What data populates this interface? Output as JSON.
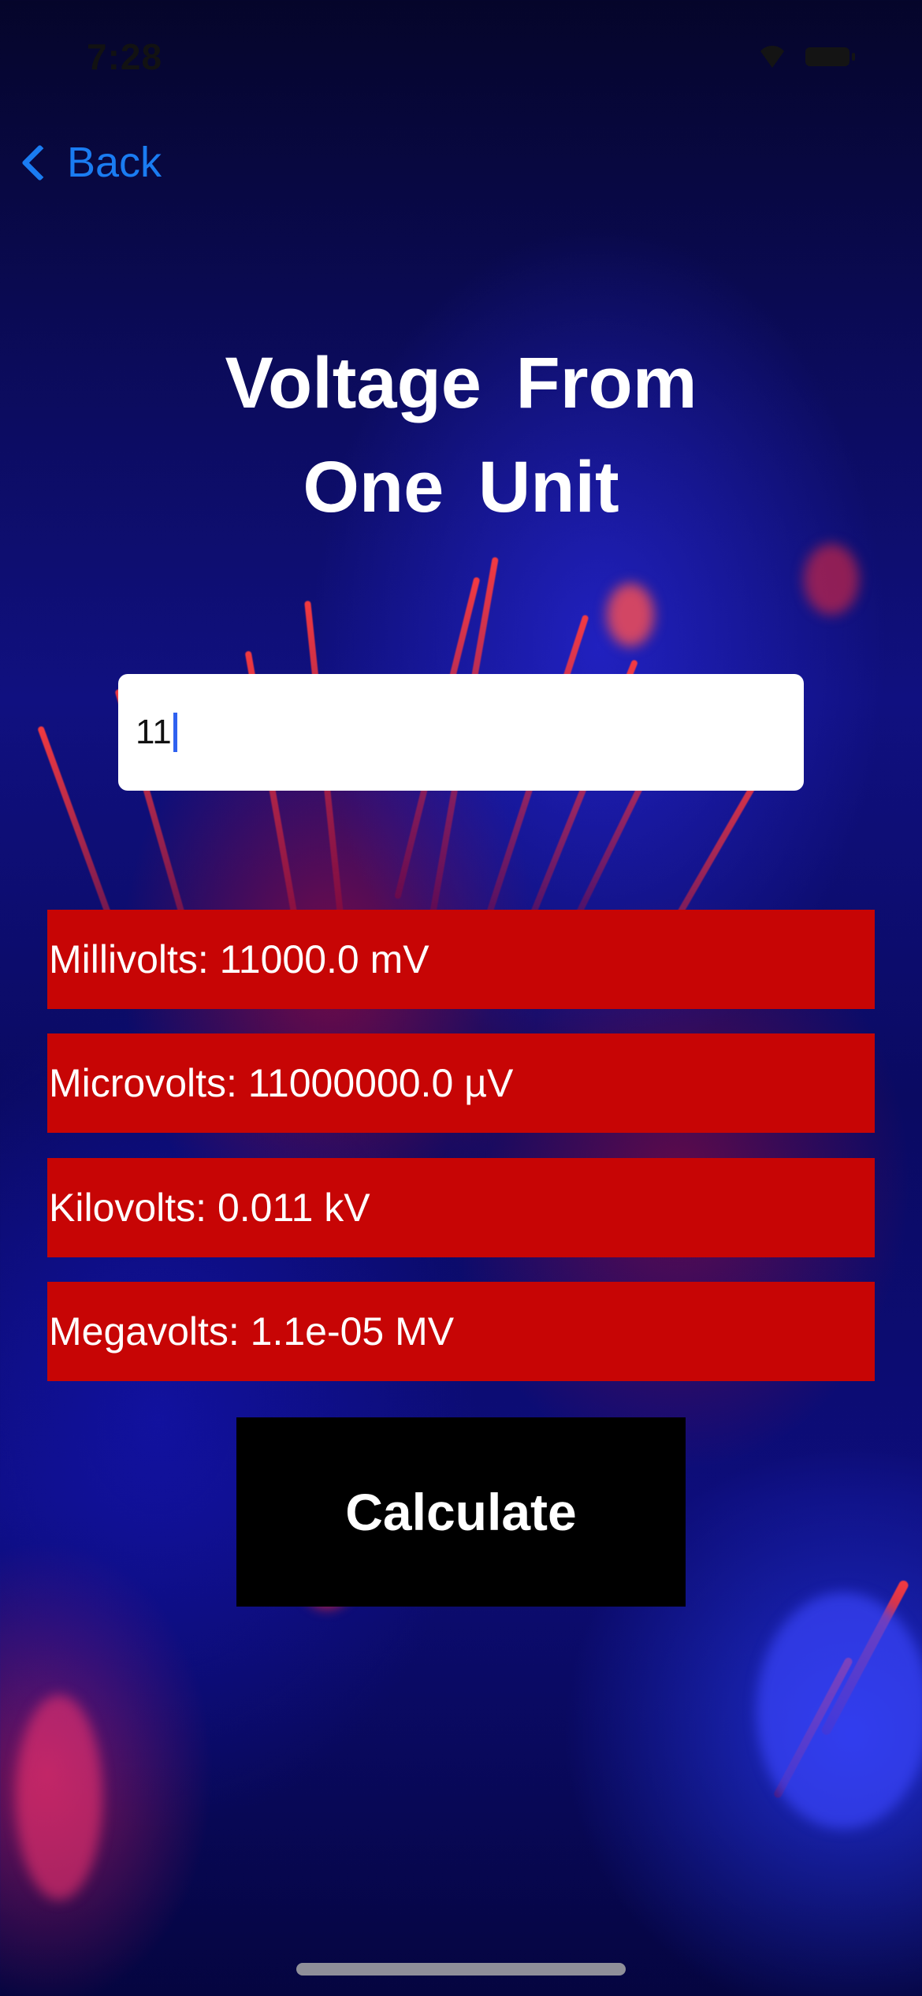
{
  "status_bar": {
    "time": "7:28",
    "icons": [
      "wifi-icon",
      "battery-icon"
    ]
  },
  "nav": {
    "back_label": "Back"
  },
  "title": {
    "line1": "Voltage From",
    "line2": "One Unit"
  },
  "input": {
    "value": "11"
  },
  "results": [
    {
      "label": "Millivolts: 11000.0 mV"
    },
    {
      "label": "Microvolts: 11000000.0 µV"
    },
    {
      "label": "Kilovolts: 0.011 kV"
    },
    {
      "label": "Megavolts: 1.1e-05 MV"
    }
  ],
  "calculate": {
    "label": "Calculate"
  },
  "colors": {
    "accent": "#1a7cf2",
    "result_bg": "#c70505",
    "button_bg": "#000000",
    "text_light": "#ffffff"
  }
}
